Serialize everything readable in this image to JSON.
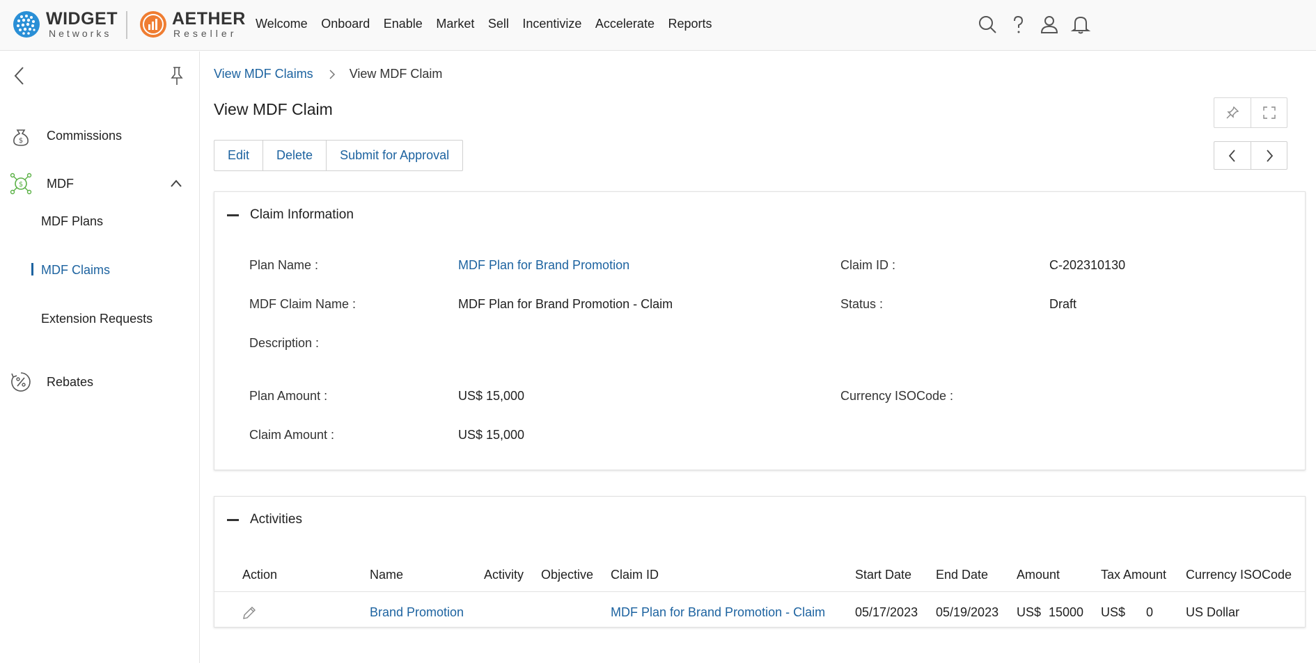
{
  "brand": {
    "left_name": "WIDGET",
    "left_sub": "Networks",
    "right_name": "AETHER",
    "right_sub": "Reseller"
  },
  "nav": [
    "Welcome",
    "Onboard",
    "Enable",
    "Market",
    "Sell",
    "Incentivize",
    "Accelerate",
    "Reports"
  ],
  "sidebar": {
    "items": {
      "commissions": "Commissions",
      "mdf": "MDF",
      "rebates": "Rebates"
    },
    "mdf_sub": {
      "plans": "MDF Plans",
      "claims": "MDF Claims",
      "extensions": "Extension Requests"
    }
  },
  "breadcrumb": {
    "parent": "View MDF Claims",
    "current": "View MDF Claim"
  },
  "page_title": "View MDF Claim",
  "actions": {
    "edit": "Edit",
    "delete": "Delete",
    "submit": "Submit for Approval"
  },
  "claim_info": {
    "title": "Claim Information",
    "plan_name_label": "Plan Name :",
    "plan_name": "MDF Plan for Brand Promotion",
    "claim_id_label": "Claim ID :",
    "claim_id": "C-202310130",
    "claim_name_label": "MDF Claim Name :",
    "claim_name": "MDF Plan for Brand Promotion - Claim",
    "status_label": "Status :",
    "status": "Draft",
    "description_label": "Description :",
    "plan_amount_label": "Plan Amount :",
    "plan_amount": "US$ 15,000",
    "currency_label": "Currency ISOCode :",
    "claim_amount_label": "Claim Amount :",
    "claim_amount": "US$ 15,000"
  },
  "activities": {
    "title": "Activities",
    "columns": {
      "action": "Action",
      "name": "Name",
      "activity": "Activity",
      "objective": "Objective",
      "claim_id": "Claim ID",
      "start": "Start Date",
      "end": "End Date",
      "amount": "Amount",
      "tax": "Tax Amount",
      "currency": "Currency ISOCode"
    },
    "rows": [
      {
        "name": "Brand Promotion",
        "claim_id": "MDF Plan for Brand Promotion - Claim",
        "start": "05/17/2023",
        "end": "05/19/2023",
        "amount_cur": "US$",
        "amount": "15000",
        "tax_cur": "US$",
        "tax": "0",
        "currency": "US Dollar"
      }
    ]
  },
  "colors": {
    "link": "#1d63a0",
    "widget_logo": "#2a8fd6",
    "aether_logo": "#ef7d32",
    "mdf_icon": "#5bb146"
  }
}
